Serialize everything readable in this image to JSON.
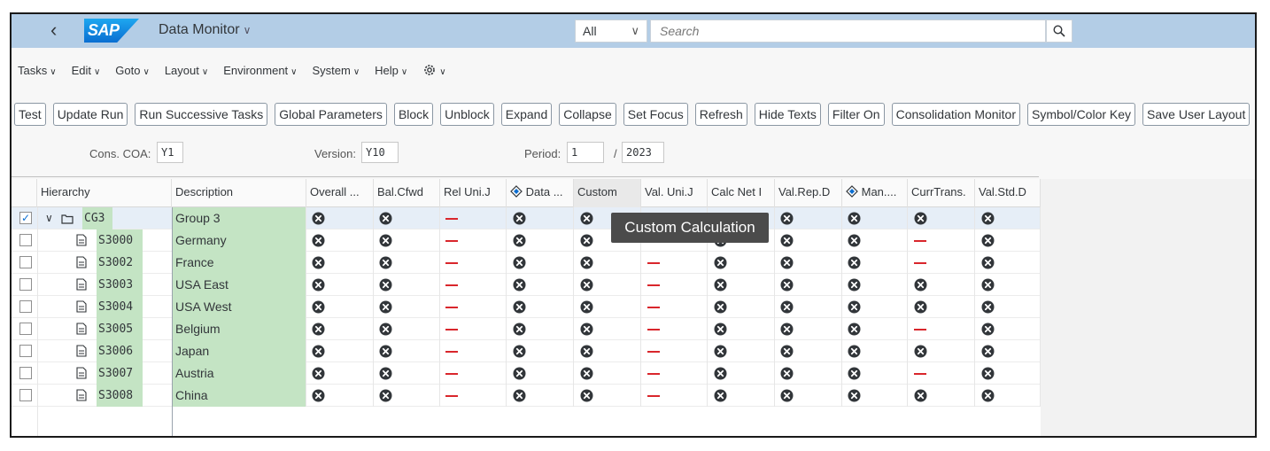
{
  "shell": {
    "back_icon": "chevron-left-icon",
    "logo": "SAP",
    "app_title": "Data Monitor",
    "scope": "All",
    "search_placeholder": "Search",
    "search_icon": "search-icon"
  },
  "menus": [
    {
      "label": "Tasks"
    },
    {
      "label": "Edit"
    },
    {
      "label": "Goto"
    },
    {
      "label": "Layout"
    },
    {
      "label": "Environment"
    },
    {
      "label": "System"
    },
    {
      "label": "Help"
    }
  ],
  "toolbar": {
    "buttons": [
      "Test",
      "Update Run",
      "Run Successive Tasks",
      "Global Parameters",
      "Block",
      "Unblock",
      "Expand",
      "Collapse",
      "Set Focus",
      "Refresh",
      "Hide Texts",
      "Filter On",
      "Consolidation Monitor",
      "Symbol/Color Key",
      "Save User Layout"
    ]
  },
  "params": {
    "coa_label": "Cons. COA:",
    "coa_value": "Y1",
    "version_label": "Version:",
    "version_value": "Y10",
    "period_label": "Period:",
    "period_value": "1",
    "year_sep": "/",
    "year_value": "2023"
  },
  "grid": {
    "columns": [
      "Hierarchy",
      "Description",
      "Overall ...",
      "Bal.Cfwd",
      "Rel Uni.J",
      "Data ...",
      "Custom",
      "Val. Uni.J",
      "Calc Net I",
      "Val.Rep.D",
      "Man....",
      "CurrTrans.",
      "Val.Std.D"
    ],
    "rows": [
      {
        "code": "CG3",
        "desc": "Group 3",
        "checked": "✓",
        "level": 0,
        "status": [
          "x",
          "x",
          "-",
          "x",
          "x",
          "",
          "",
          "x",
          "x",
          "x",
          "x"
        ]
      },
      {
        "code": "S3000",
        "desc": "Germany",
        "checked": "",
        "level": 1,
        "status": [
          "x",
          "x",
          "-",
          "x",
          "x",
          "",
          "x",
          "x",
          "x",
          "-",
          "x"
        ]
      },
      {
        "code": "S3002",
        "desc": "France",
        "checked": "",
        "level": 1,
        "status": [
          "x",
          "x",
          "-",
          "x",
          "x",
          "-",
          "x",
          "x",
          "x",
          "-",
          "x"
        ]
      },
      {
        "code": "S3003",
        "desc": "USA East",
        "checked": "",
        "level": 1,
        "status": [
          "x",
          "x",
          "-",
          "x",
          "x",
          "-",
          "x",
          "x",
          "x",
          "x",
          "x"
        ]
      },
      {
        "code": "S3004",
        "desc": "USA West",
        "checked": "",
        "level": 1,
        "status": [
          "x",
          "x",
          "-",
          "x",
          "x",
          "-",
          "x",
          "x",
          "x",
          "x",
          "x"
        ]
      },
      {
        "code": "S3005",
        "desc": "Belgium",
        "checked": "",
        "level": 1,
        "status": [
          "x",
          "x",
          "-",
          "x",
          "x",
          "-",
          "x",
          "x",
          "x",
          "-",
          "x"
        ]
      },
      {
        "code": "S3006",
        "desc": "Japan",
        "checked": "",
        "level": 1,
        "status": [
          "x",
          "x",
          "-",
          "x",
          "x",
          "-",
          "x",
          "x",
          "x",
          "x",
          "x"
        ]
      },
      {
        "code": "S3007",
        "desc": "Austria",
        "checked": "",
        "level": 1,
        "status": [
          "x",
          "x",
          "-",
          "x",
          "x",
          "-",
          "x",
          "x",
          "x",
          "-",
          "x"
        ]
      },
      {
        "code": "S3008",
        "desc": "China",
        "checked": "",
        "level": 1,
        "status": [
          "x",
          "x",
          "-",
          "x",
          "x",
          "-",
          "x",
          "x",
          "x",
          "x",
          "x"
        ]
      }
    ]
  },
  "tooltip": "Custom Calculation",
  "colors": {
    "error_icon": "#32363a",
    "dash": "#d9262c",
    "highlight": "#c4e4c4",
    "shell": "#b3cde6"
  }
}
